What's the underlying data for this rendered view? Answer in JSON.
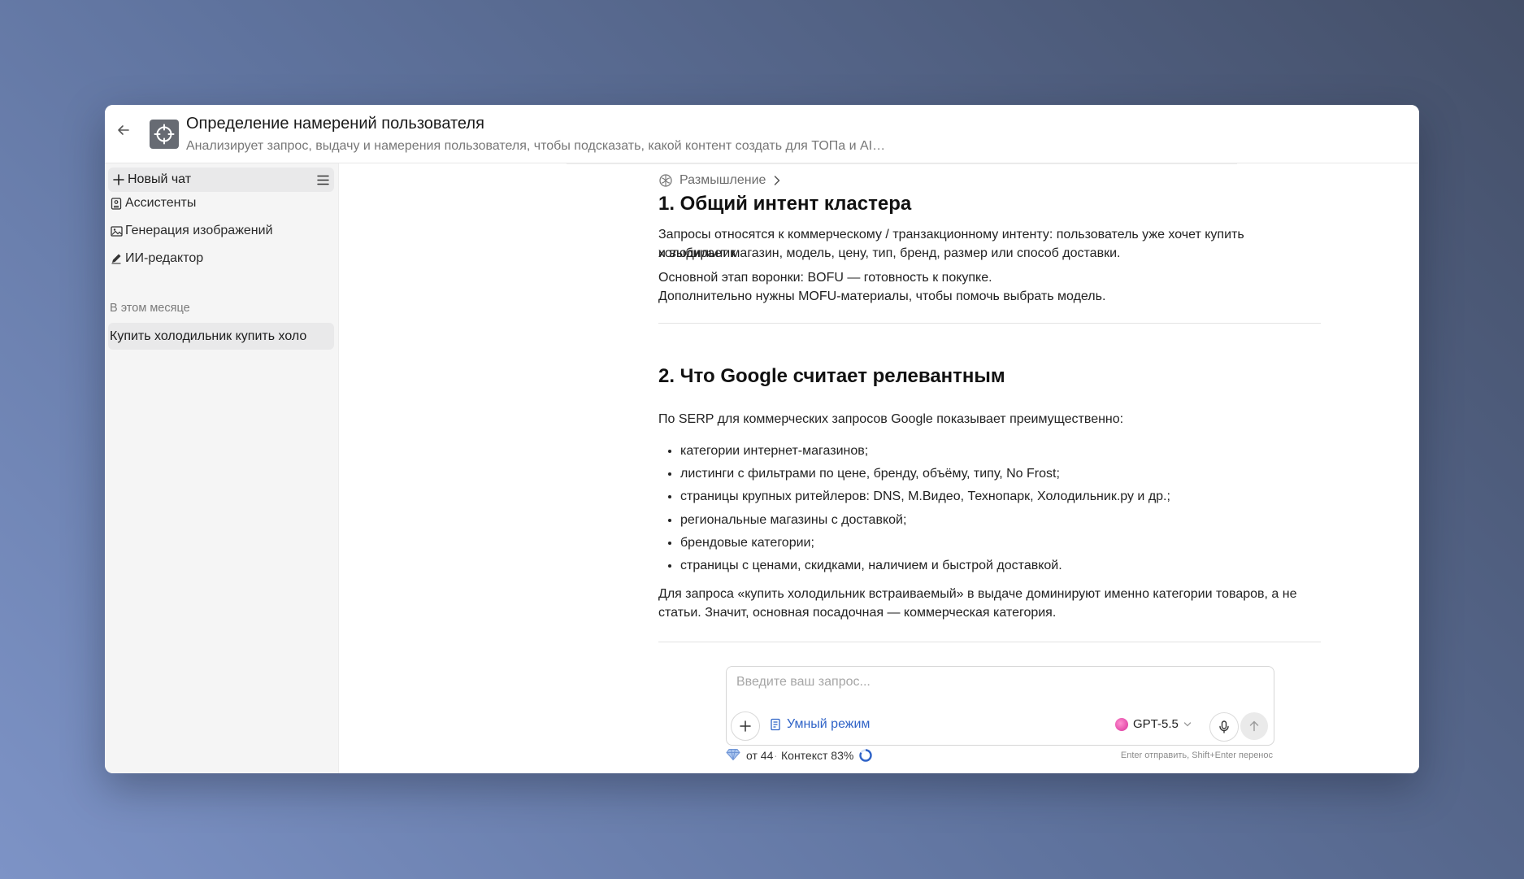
{
  "header": {
    "title": "Определение намерений пользователя",
    "subtitle": "Анализирует запрос, выдачу и намерения пользователя, чтобы подсказать, какой контент создать для ТОПа и AI…",
    "back_icon": "arrow-left-icon",
    "app_icon": "crosshair-icon"
  },
  "sidebar": {
    "new_chat_label": "Новый чат",
    "items": [
      {
        "label": "Ассистенты",
        "icon": "assistant-icon"
      },
      {
        "label": "Генерация изображений",
        "icon": "image-icon"
      },
      {
        "label": "ИИ-редактор",
        "icon": "pencil-icon"
      }
    ],
    "section_label": "В этом месяце",
    "history": [
      {
        "label": "Купить холодильник купить холо"
      }
    ]
  },
  "message": {
    "thinking_label": "Размышление",
    "section1": {
      "heading": "1. Общий интент кластера",
      "p1_line1": "Запросы относятся к коммерческому / транзакционному интенту: пользователь уже хочет купить холодильник",
      "p1_line2": "и выбирает магазин, модель, цену, тип, бренд, размер или способ доставки.",
      "p2_line1": "Основной этап воронки: BOFU — готовность к покупке.",
      "p2_line2": "Дополнительно нужны MOFU-материалы, чтобы помочь выбрать модель."
    },
    "section2": {
      "heading": "2. Что Google считает релевантным",
      "intro": "По SERP для коммерческих запросов Google показывает преимущественно:",
      "bullets": [
        "категории интернет-магазинов;",
        "листинги с фильтрами по цене, бренду, объёму, типу, No Frost;",
        "страницы крупных ритейлеров: DNS, М.Видео, Технопарк, Холодильник.ру и др.;",
        "региональные магазины с доставкой;",
        "брендовые категории;",
        "страницы с ценами, скидками, наличием и быстрой доставкой."
      ],
      "conclusion_line1": "Для запроса «купить холодильник встраиваемый» в выдаче доминируют именно категории товаров, а не",
      "conclusion_line2": "статьи. Значит, основная посадочная — коммерческая категория."
    }
  },
  "composer": {
    "placeholder": "Введите ваш запрос...",
    "value": "",
    "smart_mode_label": "Умный режим",
    "model_label": "GPT-5.5",
    "accent_color": "#2f63c7"
  },
  "status": {
    "credits": "от 44",
    "separator": "·",
    "context": "Контекст 83%",
    "hint": "Enter отправить, Shift+Enter перенос"
  }
}
